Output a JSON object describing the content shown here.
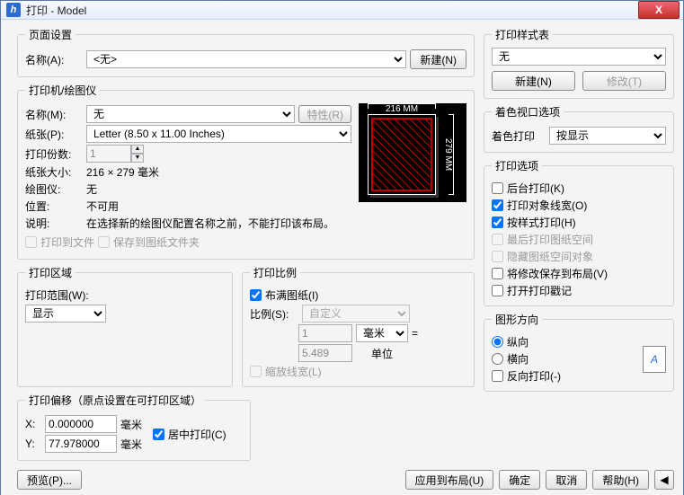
{
  "window": {
    "title": "打印 - Model",
    "close_icon": "X"
  },
  "page_setup": {
    "legend": "页面设置",
    "name_label": "名称(A):",
    "name_value": "<无>",
    "new_btn": "新建(N)"
  },
  "printer": {
    "legend": "打印机/绘图仪",
    "name_label": "名称(M):",
    "name_value": "无",
    "props_btn": "特性(R)",
    "paper_label": "纸张(P):",
    "paper_value": "Letter (8.50 x 11.00 Inches)",
    "copies_label": "打印份数:",
    "copies_value": "1",
    "size_label": "纸张大小:",
    "size_value": "216 × 279 毫米",
    "plotter_label": "绘图仪:",
    "plotter_value": "无",
    "where_label": "位置:",
    "where_value": "不可用",
    "desc_label": "说明:",
    "desc_value": "在选择新的绘图仪配置名称之前，不能打印该布局。",
    "to_file": "打印到文件",
    "save_sheet": "保存到图纸文件夹",
    "preview": {
      "dim_top": "216 MM",
      "dim_right": "279 MM"
    }
  },
  "area": {
    "legend": "打印区域",
    "range_label": "打印范围(W):",
    "range_value": "显示"
  },
  "scale": {
    "legend": "打印比例",
    "fit": "布满图纸(I)",
    "ratio_label": "比例(S):",
    "ratio_value": "自定义",
    "num": "1",
    "unit_sel": "毫米",
    "eq": "=",
    "den": "5.489",
    "unit_txt": "单位",
    "scale_lw": "缩放线宽(L)"
  },
  "offset": {
    "legend": "打印偏移（原点设置在可打印区域）",
    "x_label": "X:",
    "x_val": "0.000000",
    "x_unit": "毫米",
    "y_label": "Y:",
    "y_val": "77.978000",
    "y_unit": "毫米",
    "center": "居中打印(C)"
  },
  "style": {
    "legend": "打印样式表",
    "value": "无",
    "new_btn": "新建(N)",
    "edit_btn": "修改(T)"
  },
  "viewport": {
    "legend": "着色视口选项",
    "shade_label": "着色打印",
    "shade_value": "按显示"
  },
  "options": {
    "legend": "打印选项",
    "bg": "后台打印(K)",
    "lw": "打印对象线宽(O)",
    "style": "按样式打印(H)",
    "paperspace": "最后打印图纸空间",
    "hide": "隐藏图纸空间对象",
    "save_layout": "将修改保存到布局(V)",
    "stamp": "打开打印戳记"
  },
  "orient": {
    "legend": "图形方向",
    "portrait": "纵向",
    "landscape": "横向",
    "upside": "反向打印(-)",
    "icon_glyph": "A"
  },
  "footer": {
    "preview": "预览(P)...",
    "apply": "应用到布局(U)",
    "ok": "确定",
    "cancel": "取消",
    "help": "帮助(H)",
    "expand": "◀"
  }
}
